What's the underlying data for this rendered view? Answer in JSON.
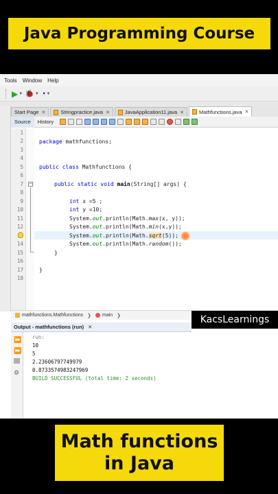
{
  "banner_top": "Java Programming Course",
  "banner_bottom": [
    "Math functions",
    "in Java"
  ],
  "watermark": "KacsLearnings",
  "menubar": [
    "Tools",
    "Window",
    "Help"
  ],
  "tabs": [
    {
      "label": "Start Page",
      "active": false
    },
    {
      "label": "Stringpractice.java",
      "active": false
    },
    {
      "label": "JavaApplication11.java",
      "active": false
    },
    {
      "label": "Mathfunctions.java",
      "active": true
    }
  ],
  "editor_tabs": {
    "source": "Source",
    "history": "History"
  },
  "line_numbers": [
    "1",
    "2",
    "3",
    "4",
    "5",
    "6",
    "7",
    "8",
    "9",
    "10",
    "11",
    "12",
    "13",
    "14",
    "15",
    "16",
    "17",
    "18"
  ],
  "code": {
    "l3_kw": "package",
    "l3_rest": " mathfunctions;",
    "l5_kw": "public class",
    "l5_rest": " Mathfunctions {",
    "l7_kw": "public static void",
    "l7_fn": "main",
    "l7_rest": "(String[] args) {",
    "l9_kw": "int",
    "l9_rest": " x =5 ;",
    "l10_kw": "int",
    "l10_rest": " y =10;",
    "l11_a": "System.",
    "l11_out": "out",
    "l11_b": ".println(Math.",
    "l11_m": "max",
    "l11_c": "(x, y));",
    "l12_a": "System.",
    "l12_out": "out",
    "l12_b": ".println(Math.",
    "l12_m": "min",
    "l12_c": "(x,y));",
    "l13_a": "System.",
    "l13_out": "out",
    "l13_b": ".println(Math.",
    "l13_m": "sqrt",
    "l13_c": "(5));",
    "l14_a": "System.",
    "l14_out": "out",
    "l14_b": ".println(Math.",
    "l14_m": "random",
    "l14_c": "());",
    "l15": "}",
    "l17": "}"
  },
  "navigator": {
    "cls": "mathfunctions.Mathfunctions",
    "method": "main"
  },
  "output": {
    "title": "Output - mathfunctions (run)",
    "lines": [
      "run:",
      "10",
      "5",
      "2.23606797749979",
      "0.8733574983247969",
      "BUILD SUCCESSFUL (total time: 2 seconds)"
    ]
  }
}
